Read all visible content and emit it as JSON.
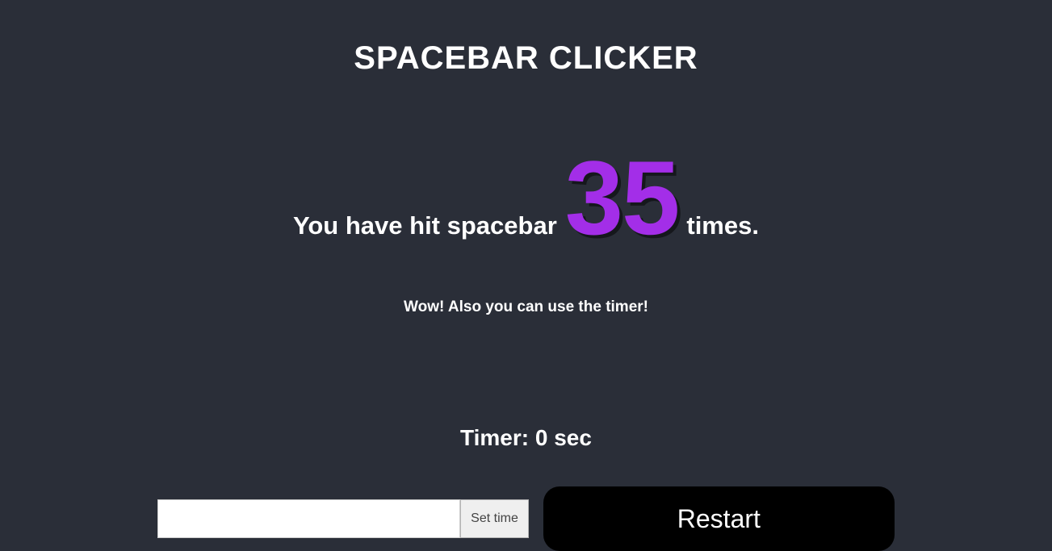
{
  "title": "SPACEBAR CLICKER",
  "counter": {
    "prefix": "You have hit spacebar",
    "value": "35",
    "suffix": "times."
  },
  "hint": "Wow! Also you can use the timer!",
  "timer": {
    "label": "Timer: 0 sec"
  },
  "controls": {
    "time_input_value": "",
    "set_time_label": "Set time",
    "restart_label": "Restart"
  }
}
